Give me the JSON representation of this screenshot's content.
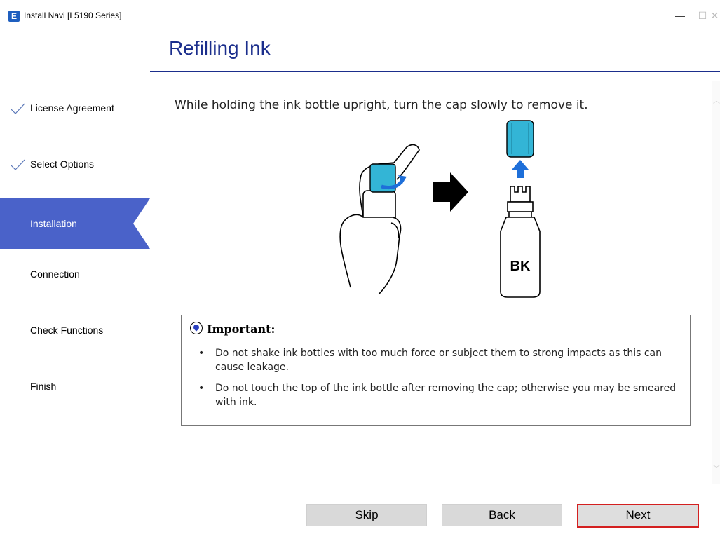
{
  "window": {
    "app_icon_glyph": "E",
    "title": "Install Navi [L5190 Series]"
  },
  "header": {
    "title": "Refilling Ink"
  },
  "sidebar": {
    "steps": [
      {
        "label": "License Agreement",
        "state": "done"
      },
      {
        "label": "Select Options",
        "state": "done"
      },
      {
        "label": "Installation",
        "state": "active"
      },
      {
        "label": "Connection",
        "state": "pending"
      },
      {
        "label": "Check Functions",
        "state": "pending"
      },
      {
        "label": "Finish",
        "state": "pending"
      }
    ]
  },
  "content": {
    "instruction": "While holding the ink bottle upright, turn the cap slowly to remove it.",
    "bottle_label": "BK",
    "important": {
      "heading": "Important:",
      "bullets": [
        "Do not shake ink bottles with too much force or subject them to strong impacts as this can cause leakage.",
        "Do not touch the top of the ink bottle after removing the cap; otherwise you may be smeared with ink."
      ]
    }
  },
  "footer": {
    "skip_label": "Skip",
    "back_label": "Back",
    "next_label": "Next"
  },
  "colors": {
    "accent": "#4a62c9",
    "title": "#1b2e8c",
    "ink_cap": "#33b5d6",
    "arrow_blue": "#1e6fd9",
    "next_border": "#d42020"
  }
}
